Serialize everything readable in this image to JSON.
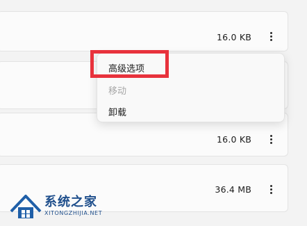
{
  "apps": [
    {
      "size": "16.0 KB"
    },
    {
      "size": "16.0 KB"
    },
    {
      "size": "36.4 MB"
    }
  ],
  "context_menu": {
    "items": [
      {
        "label": "高级选项",
        "enabled": true
      },
      {
        "label": "移动",
        "enabled": false
      },
      {
        "label": "卸载",
        "enabled": true
      }
    ]
  },
  "highlight_color": "#e8323c",
  "watermark": {
    "name": "系统之家",
    "url": "XITONGZHIJIA.NET"
  }
}
